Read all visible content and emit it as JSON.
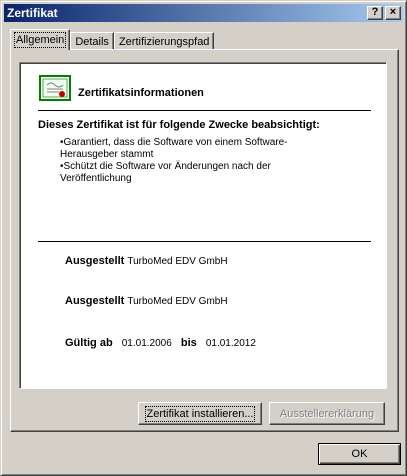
{
  "window": {
    "title": "Zertifikat",
    "help_label": "?",
    "close_label": "×"
  },
  "tabs": [
    {
      "label": "Allgemein",
      "active": true
    },
    {
      "label": "Details",
      "active": false
    },
    {
      "label": "Zertifizierungspfad",
      "active": false
    }
  ],
  "info": {
    "title": "Zertifikatsinformationen",
    "purpose_heading": "Dieses Zertifikat ist für folgende Zwecke beabsichtigt:",
    "purposes": [
      "•Garantiert, dass die Software von einem Software-",
      "Herausgeber stammt",
      "•Schützt die Software vor Änderungen nach der",
      "Veröffentlichung"
    ]
  },
  "details": {
    "issued_to_label": "Ausgestellt",
    "issued_to_value": "TurboMed EDV GmbH",
    "issued_by_label": "Ausgestellt",
    "issued_by_value": "TurboMed EDV GmbH",
    "valid_from_label": "Gültig ab",
    "valid_from_value": "01.01.2006",
    "valid_to_label": "bis",
    "valid_to_value": "01.01.2012"
  },
  "buttons": {
    "install": "Zertifikat installieren...",
    "issuer_statement": "Ausstellererklärung",
    "ok": "OK"
  },
  "colors": {
    "face": "#d4d0c8",
    "title_start": "#0a246a",
    "title_end": "#a6caf0"
  }
}
